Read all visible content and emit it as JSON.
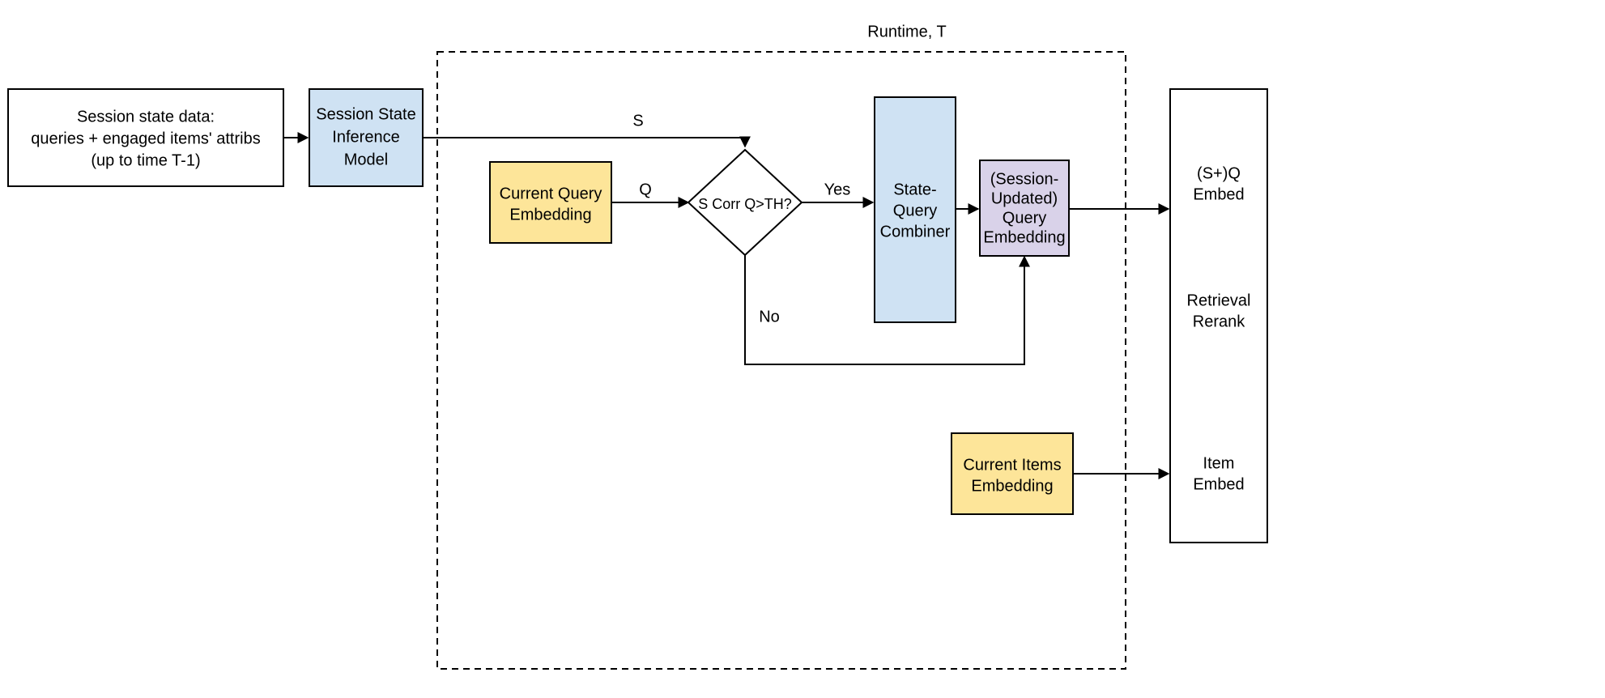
{
  "title": "Runtime, T",
  "boxes": {
    "session_data": {
      "line1": "Session state data:",
      "line2": "queries  + engaged items' attribs",
      "line3": "(up to time T-1)"
    },
    "inference_model": {
      "line1": "Session State",
      "line2": "Inference",
      "line3": "Model"
    },
    "current_query": {
      "line1": "Current Query",
      "line2": "Embedding"
    },
    "decision": {
      "text": "S Corr Q>TH?"
    },
    "combiner": {
      "line1": "State-",
      "line2": "Query",
      "line3": "Combiner"
    },
    "updated_query": {
      "line1": "(Session-",
      "line2": "Updated)",
      "line3": "Query",
      "line4": "Embedding"
    },
    "current_items": {
      "line1": "Current Items",
      "line2": "Embedding"
    },
    "output": {
      "sq_line1": "(S+)Q",
      "sq_line2": "Embed",
      "mid_line1": "Retrieval",
      "mid_line2": "Rerank",
      "item_line1": "Item",
      "item_line2": "Embed"
    }
  },
  "edges": {
    "s": "S",
    "q": "Q",
    "yes": "Yes",
    "no": "No"
  },
  "colors": {
    "blue": "#cfe2f3",
    "yellow": "#fde599",
    "purple": "#d9d2e9",
    "stroke": "#000000"
  }
}
